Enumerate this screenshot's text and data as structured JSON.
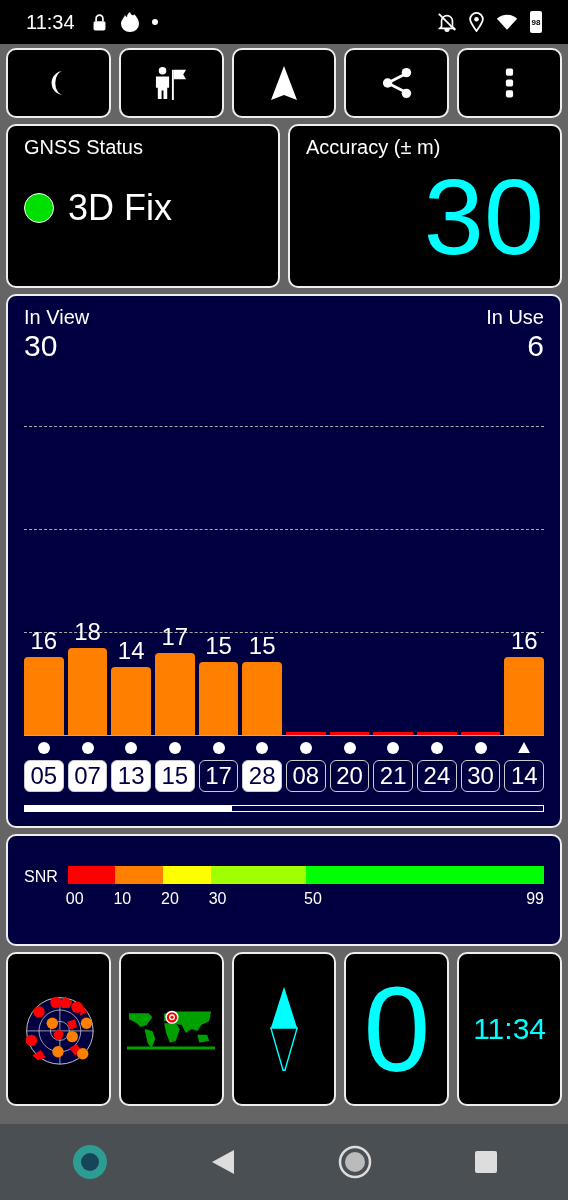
{
  "status_bar": {
    "time": "11:34",
    "battery": "98"
  },
  "gnss": {
    "title": "GNSS Status",
    "fix": "3D Fix",
    "color": "#00e000"
  },
  "accuracy": {
    "title": "Accuracy (± m)",
    "value": "30"
  },
  "sky": {
    "in_view_label": "In View",
    "in_view": "30",
    "in_use_label": "In Use",
    "in_use": "6",
    "satellites": [
      {
        "prn": "05",
        "snr": "16",
        "used": true,
        "kind": "circle"
      },
      {
        "prn": "07",
        "snr": "18",
        "used": true,
        "kind": "circle"
      },
      {
        "prn": "13",
        "snr": "14",
        "used": true,
        "kind": "circle"
      },
      {
        "prn": "15",
        "snr": "17",
        "used": true,
        "kind": "circle"
      },
      {
        "prn": "17",
        "snr": "15",
        "used": false,
        "kind": "circle"
      },
      {
        "prn": "28",
        "snr": "15",
        "used": true,
        "kind": "circle"
      },
      {
        "prn": "08",
        "used": false,
        "kind": "circle"
      },
      {
        "prn": "20",
        "used": false,
        "kind": "circle"
      },
      {
        "prn": "21",
        "used": false,
        "kind": "circle"
      },
      {
        "prn": "24",
        "used": false,
        "kind": "circle"
      },
      {
        "prn": "30",
        "used": false,
        "kind": "circle"
      },
      {
        "prn": "14",
        "snr": "16",
        "used": false,
        "kind": "triangle"
      }
    ]
  },
  "snr": {
    "label": "SNR",
    "segments": [
      {
        "from": "00",
        "color": "#ff0000"
      },
      {
        "from": "10",
        "color": "#ff8000"
      },
      {
        "from": "20",
        "color": "#ffff00"
      },
      {
        "from": "30",
        "color": "#a0ff00"
      },
      {
        "from": "50",
        "color": "#00ff00"
      }
    ],
    "end": "99"
  },
  "tiles": {
    "speed": "0",
    "clock": "11:34"
  }
}
